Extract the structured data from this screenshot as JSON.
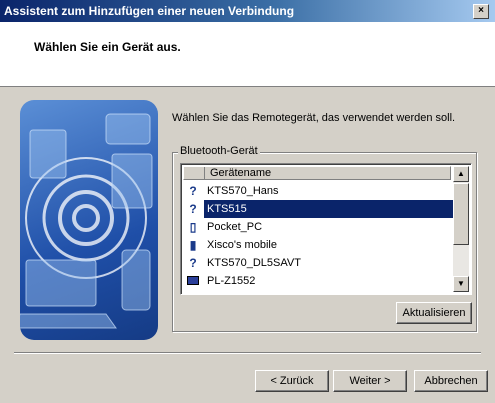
{
  "window": {
    "title": "Assistent zum Hinzufügen einer neuen Verbindung",
    "close_glyph": "×"
  },
  "header": {
    "title": "Wählen Sie ein Gerät aus."
  },
  "content": {
    "instruction": "Wählen Sie das Remotegerät, das verwendet werden soll.",
    "group_label": "Bluetooth-Gerät",
    "column_header": "Gerätename",
    "devices": [
      {
        "icon": "bluetooth-unknown-icon",
        "glyph": "?",
        "name": "KTS570_Hans"
      },
      {
        "icon": "bluetooth-unknown-icon",
        "glyph": "?",
        "name": "KTS515",
        "selected": true
      },
      {
        "icon": "pda-icon",
        "glyph": "▯",
        "name": "Pocket_PC"
      },
      {
        "icon": "mobile-phone-icon",
        "glyph": "▮",
        "name": "Xisco's mobile"
      },
      {
        "icon": "bluetooth-unknown-icon",
        "glyph": "?",
        "name": "KTS570_DL5SAVT"
      },
      {
        "icon": "computer-icon",
        "glyph": "",
        "name": "PL-Z1552"
      }
    ],
    "refresh_label": "Aktualisieren"
  },
  "footer": {
    "back_label": "< Zurück",
    "next_label": "Weiter >",
    "cancel_label": "Abbrechen"
  },
  "colors": {
    "title_bar": "#0a246a",
    "selection": "#0a246a",
    "face": "#d4d0c8"
  }
}
